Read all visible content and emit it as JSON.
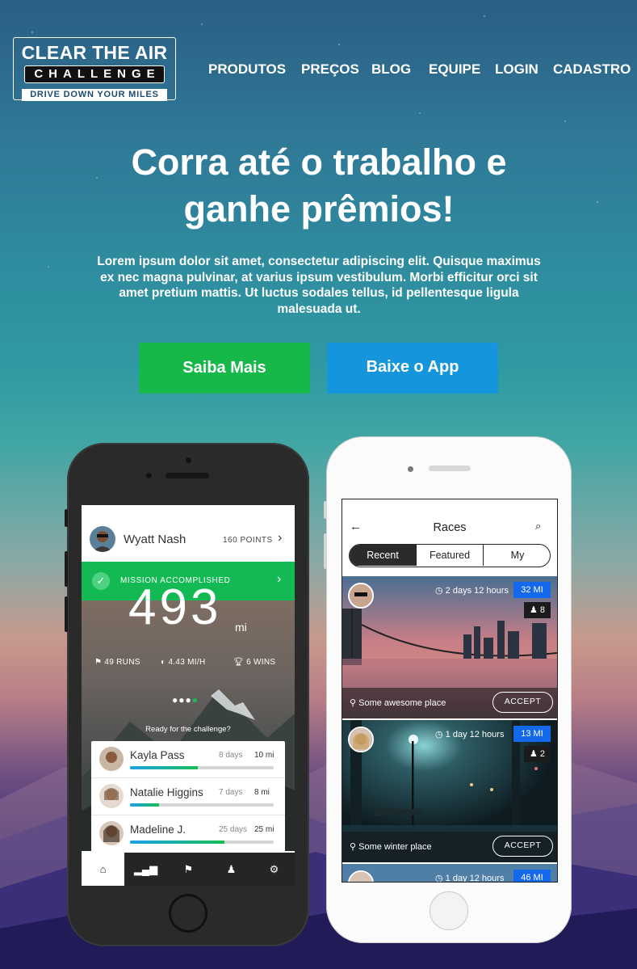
{
  "brand": {
    "line1": "CLEAR THE AIR",
    "line2": "CHALLENGE",
    "tagline": "DRIVE DOWN YOUR MILES"
  },
  "nav": {
    "items": [
      "PRODUTOS",
      "PREÇOS",
      "BLOG",
      "EQUIPE",
      "LOGIN",
      "CADASTRO"
    ]
  },
  "hero": {
    "title": "Corra até o trabalho e ganhe prêmios!",
    "text": "Lorem ipsum dolor sit amet, consectetur adipiscing elit. Quisque maximus ex nec magna pulvinar, at varius ipsum vestibulum. Morbi efficitur orci sit amet pretium mattis. Ut luctus sodales tellus, id pellentesque ligula malesuada ut.",
    "primary_button": "Saiba Mais",
    "secondary_button": "Baixe o App"
  },
  "colors": {
    "green": "#17b84a",
    "blue": "#1596dc",
    "badge_blue": "#1468ec"
  },
  "app_stats": {
    "user_name": "Wyatt Nash",
    "points": "160 POINTS",
    "mission": "MISSION ACCOMPLISHED",
    "total": "493",
    "unit": "mi",
    "runs": "49 RUNS",
    "speed": "4.43 MI/H",
    "wins": "6 WINS",
    "prompt": "Ready for the challenge?",
    "leaderboard": [
      {
        "name": "Kayla Pass",
        "days": "8 days",
        "miles": "10 mi",
        "progress": 0.47
      },
      {
        "name": "Natalie Higgins",
        "days": "7 days",
        "miles": "8 mi",
        "progress": 0.2
      },
      {
        "name": "Madeline J.",
        "days": "25 days",
        "miles": "25 mi",
        "progress": 0.66
      }
    ],
    "tabs": [
      "home-icon",
      "stats-icon",
      "flag-icon",
      "person-icon",
      "gear-icon"
    ]
  },
  "app_races": {
    "title": "Races",
    "segments": [
      "Recent",
      "Featured",
      "My"
    ],
    "accept_label": "ACCEPT",
    "races": [
      {
        "time": "2 days 12 hours",
        "miles": "32 MI",
        "participants": "8",
        "place": "Some awesome place"
      },
      {
        "time": "1 day 12 hours",
        "miles": "13 MI",
        "participants": "2",
        "place": "Some winter place"
      },
      {
        "time": "1 day 12 hours",
        "miles": "46 MI",
        "participants": "",
        "place": ""
      }
    ]
  }
}
